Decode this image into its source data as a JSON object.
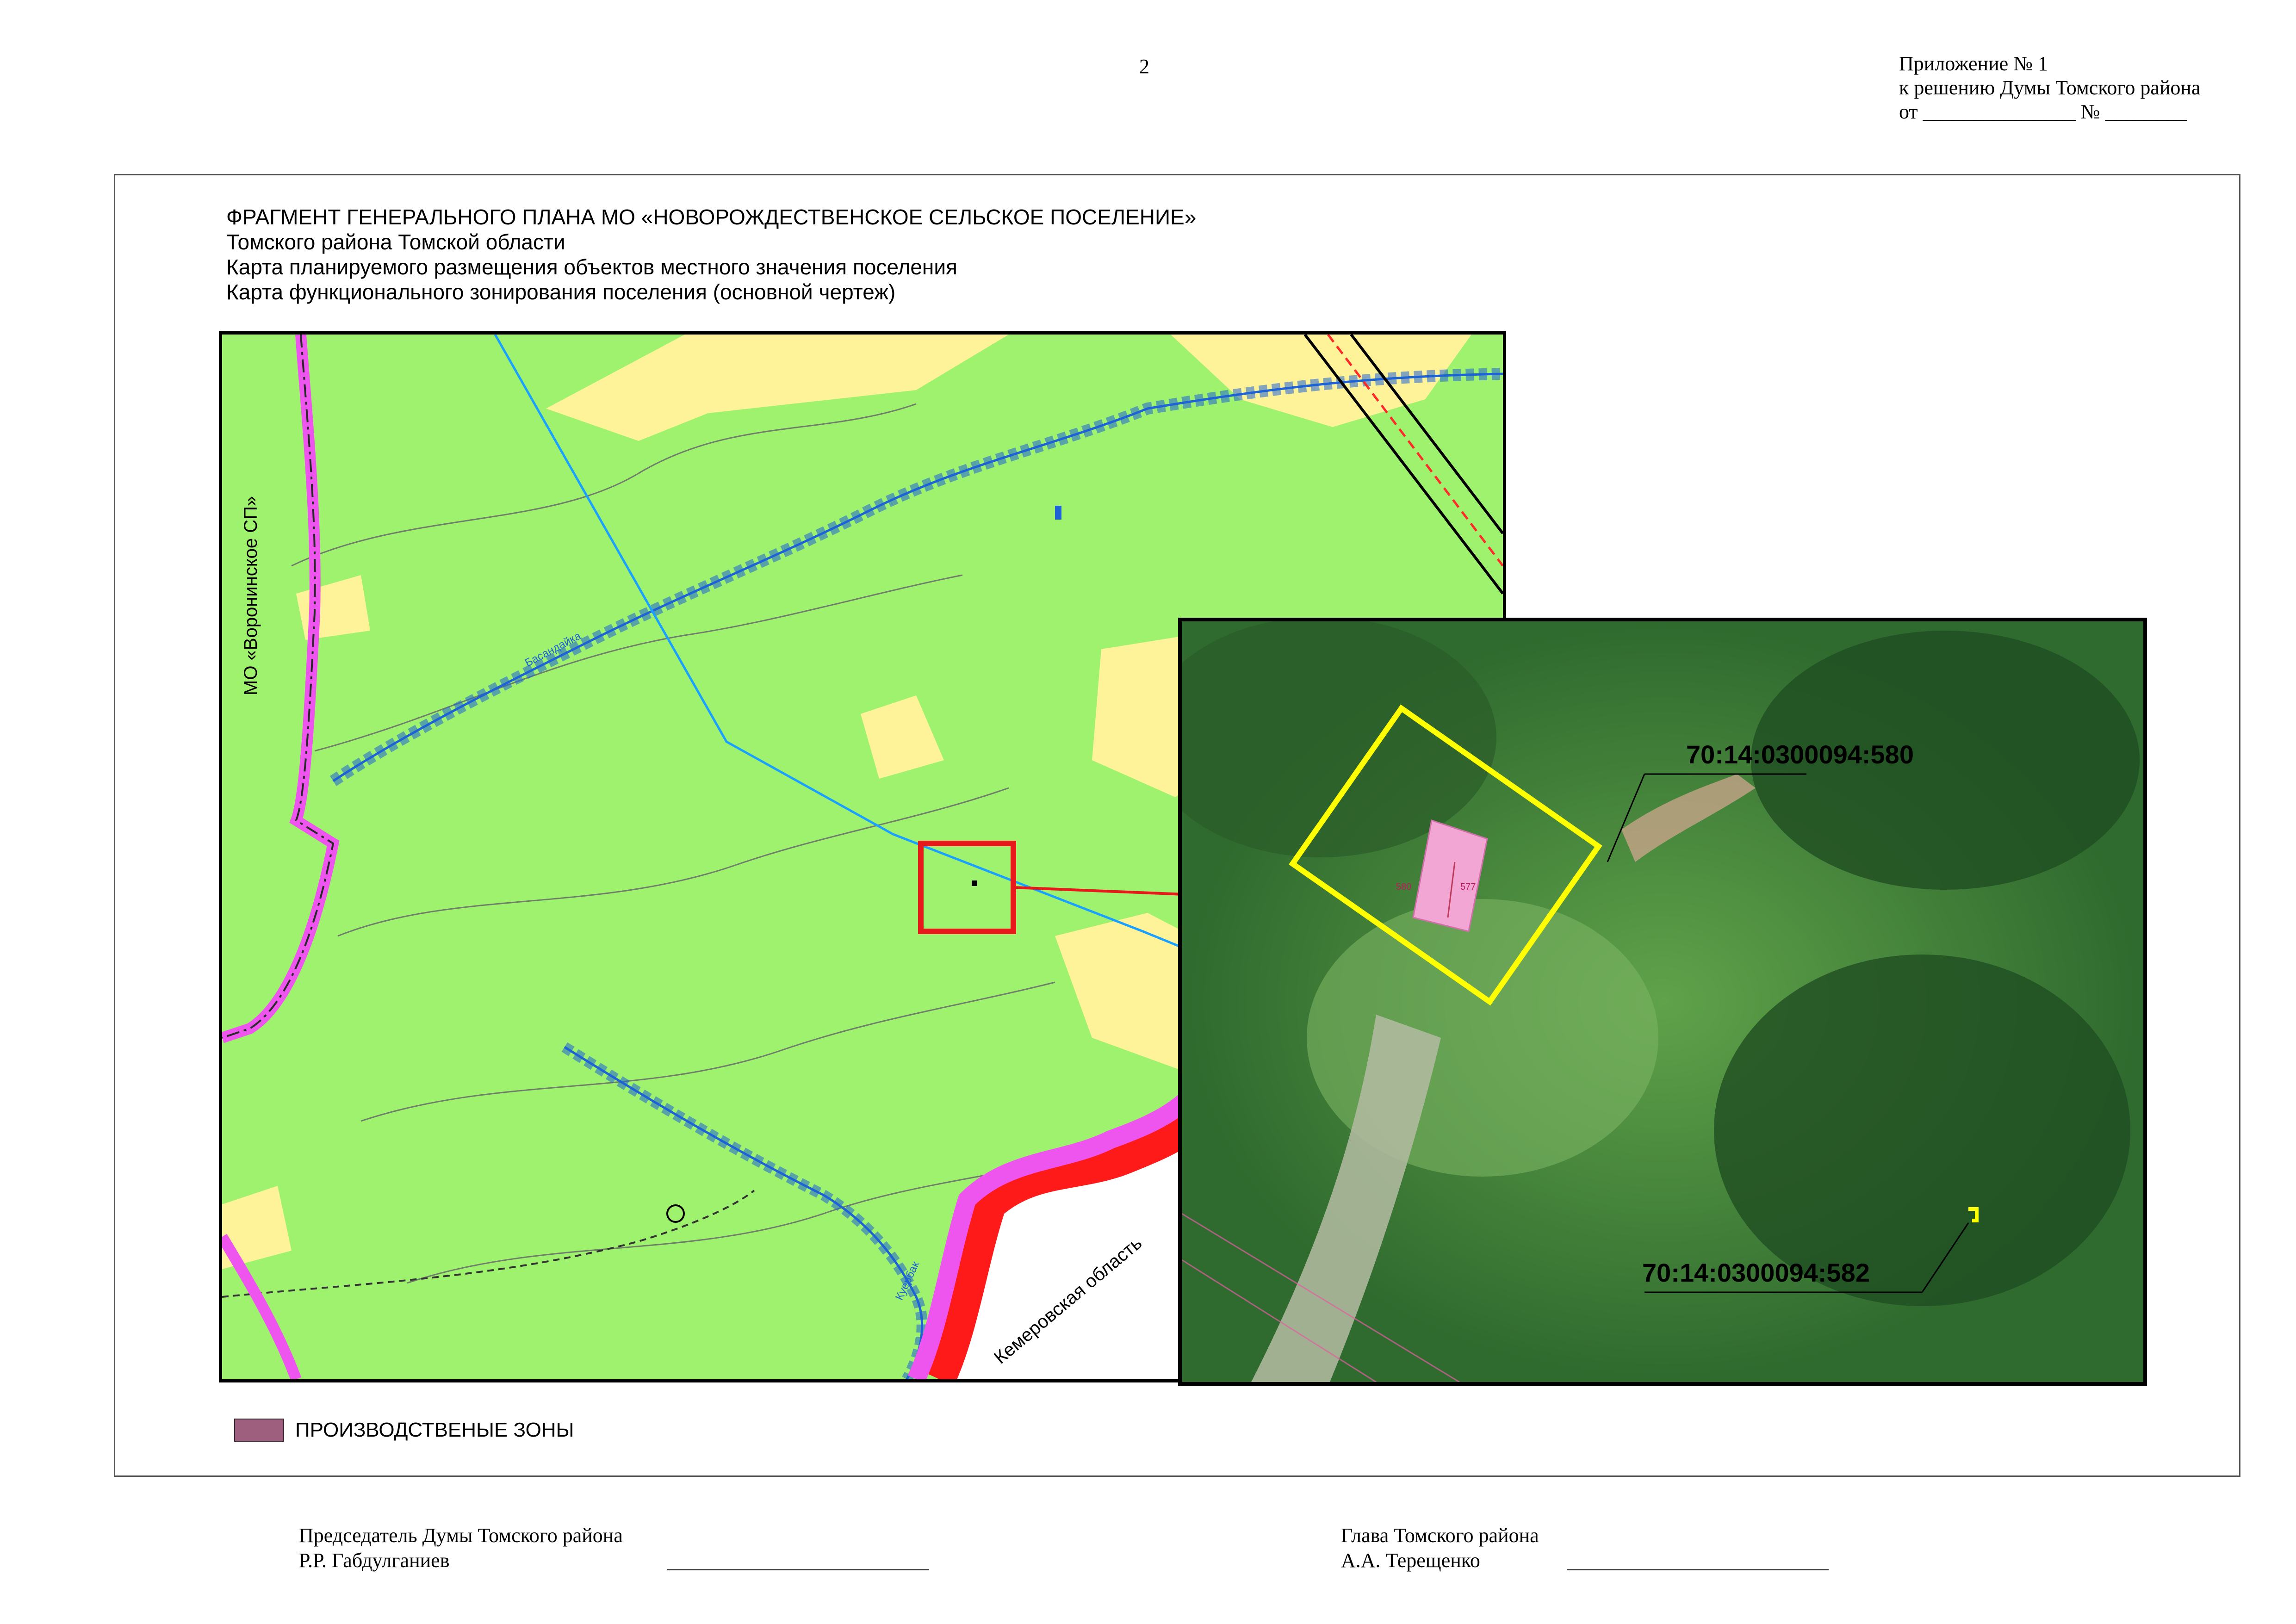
{
  "page": {
    "number": "2",
    "appendix": {
      "line1": "Приложение № 1",
      "line2": "к решению Думы Томского района",
      "line3": "от _______________ № ________"
    }
  },
  "title": {
    "line1": "ФРАГМЕНТ ГЕНЕРАЛЬНОГО ПЛАНА МО «НОВОРОЖДЕСТВЕНСКОЕ СЕЛЬСКОЕ ПОСЕЛЕНИЕ»",
    "line2": "Томского района Томской области",
    "line3": "Карта планируемого размещения объектов местного значения поселения",
    "line4": "Карта функционального зонирования поселения (основной чертеж)"
  },
  "map": {
    "labels": {
      "neighbor": "МО «Воронинское СП»",
      "region": "Кемеровская область",
      "river1": "Басандайка",
      "river2": "Куербак"
    },
    "colors": {
      "forest": "#9ef26e",
      "agricultural": "#fff39a",
      "boundary": "#ee55ee",
      "region_boundary": "#ff1a1a",
      "water": "#1e63d6",
      "highlight": "#e8191b"
    }
  },
  "inset": {
    "parcel_main": "70:14:0300094:580",
    "parcel_small": "70:14:0300094:582",
    "building_labels": {
      "left": "580",
      "right": "577"
    },
    "colors": {
      "frame": "#ffff00",
      "building": "#f2a6d4"
    }
  },
  "legend": {
    "items": [
      {
        "label": "ПРОИЗВОДСТВЕНЫЕ ЗОНЫ",
        "color": "#9e5e7e"
      }
    ]
  },
  "signatures": {
    "left": {
      "title": "Председатель Думы Томского района",
      "name": "Р.Р. Габдулганиев"
    },
    "right": {
      "title": "Глава Томского района",
      "name": "А.А. Терещенко"
    }
  }
}
